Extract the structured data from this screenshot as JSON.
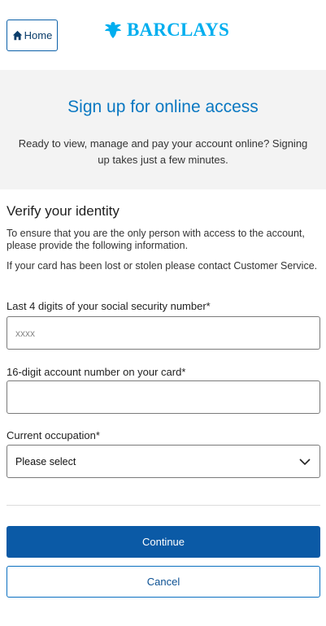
{
  "header": {
    "home_label": "Home",
    "brand_name": "BARCLAYS",
    "brand_color": "#00aeef"
  },
  "banner": {
    "title": "Sign up for online access",
    "subtitle": "Ready to view, manage and pay your account online? Signing up takes just a few minutes."
  },
  "verify": {
    "title": "Verify your identity",
    "intro": "To ensure that you are the only person with access to the account, please provide the following information.",
    "lost_card_note": "If your card has been lost or stolen please contact Customer Service."
  },
  "form": {
    "ssn": {
      "label": "Last 4 digits of your social security number*",
      "placeholder": "xxxx",
      "value": ""
    },
    "account": {
      "label": "16-digit account number on your card*",
      "placeholder": "",
      "value": ""
    },
    "occupation": {
      "label": "Current occupation*",
      "selected": "Please select"
    }
  },
  "actions": {
    "continue_label": "Continue",
    "cancel_label": "Cancel",
    "primary_color": "#0b5aa6"
  },
  "icons": {
    "home": "home-icon",
    "logo": "eagle-logo-icon",
    "chevron": "chevron-down-icon"
  }
}
